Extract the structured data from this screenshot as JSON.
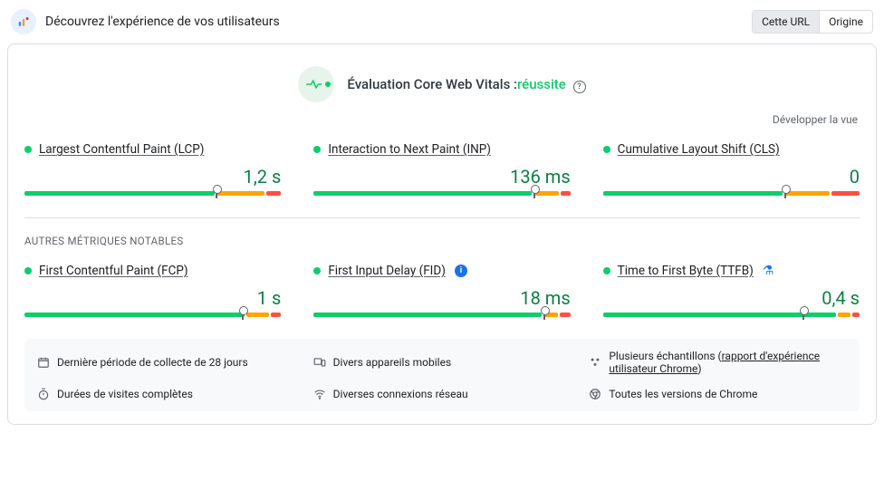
{
  "header": {
    "title": "Découvrez l'expérience de vos utilisateurs",
    "tab_url": "Cette URL",
    "tab_origin": "Origine"
  },
  "assessment": {
    "label": "Évaluation Core Web Vitals :",
    "result": "réussite",
    "expand": "Développer la vue"
  },
  "core": [
    {
      "name": "Largest Contentful Paint (LCP)",
      "value": "1,2 s",
      "g": 75,
      "o": 19,
      "r": 6,
      "mark": 75
    },
    {
      "name": "Interaction to Next Paint (INP)",
      "value": "136 ms",
      "g": 86,
      "o": 10,
      "r": 4,
      "mark": 86
    },
    {
      "name": "Cumulative Layout Shift (CLS)",
      "value": "0",
      "g": 71,
      "o": 18,
      "r": 11,
      "mark": 71
    }
  ],
  "other_label": "AUTRES MÉTRIQUES NOTABLES",
  "other": [
    {
      "name": "First Contentful Paint (FCP)",
      "value": "1 s",
      "g": 87,
      "o": 9,
      "r": 4,
      "mark": 85,
      "badge": ""
    },
    {
      "name": "First Input Delay (FID)",
      "value": "18 ms",
      "g": 90,
      "o": 6,
      "r": 4,
      "mark": 90,
      "badge": "info"
    },
    {
      "name": "Time to First Byte (TTFB)",
      "value": "0,4 s",
      "g": 92,
      "o": 5,
      "r": 3,
      "mark": 78,
      "badge": "flask"
    }
  ],
  "footer": {
    "period": "Dernière période de collecte de 28 jours",
    "devices": "Divers appareils mobiles",
    "samples_prefix": "Plusieurs échantillons (",
    "samples_link": "rapport d'expérience utilisateur Chrome",
    "samples_suffix": ")",
    "sessions": "Durées de visites complètes",
    "networks": "Diverses connexions réseau",
    "versions": "Toutes les versions de Chrome"
  }
}
